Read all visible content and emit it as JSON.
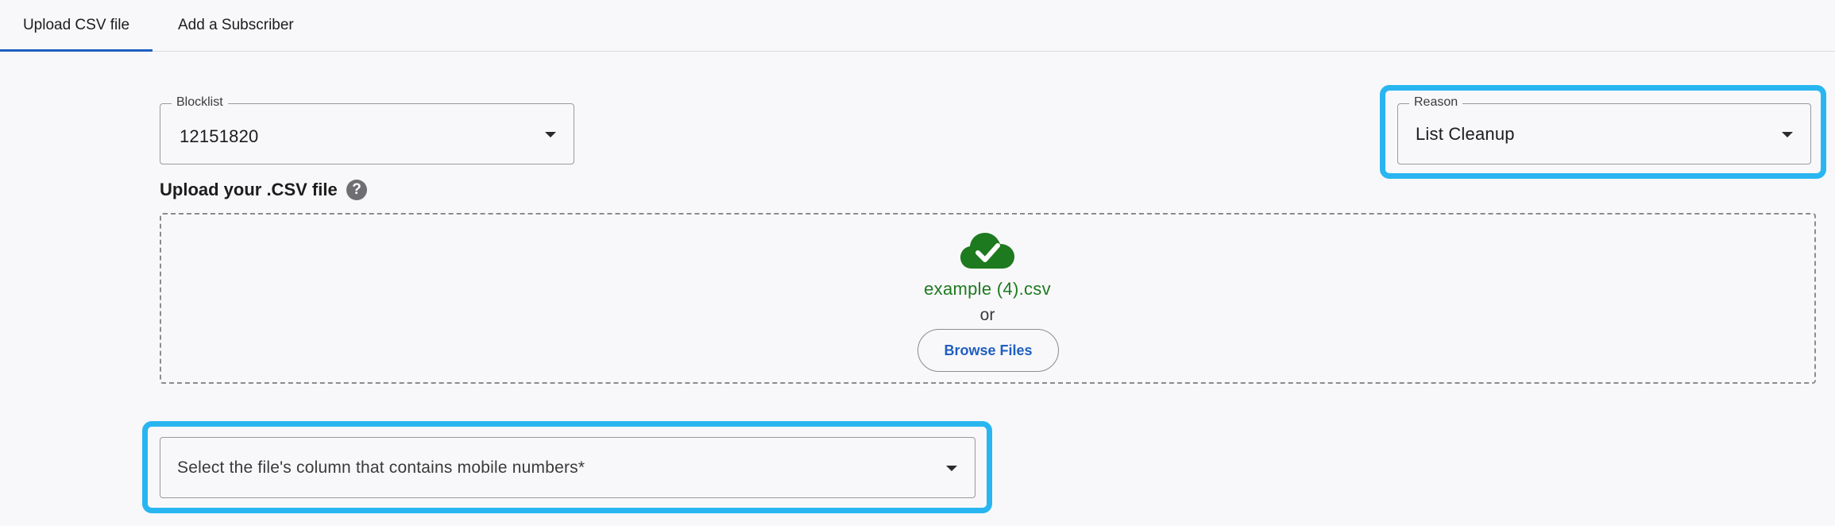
{
  "tabs": [
    {
      "label": "Upload CSV file",
      "active": true
    },
    {
      "label": "Add a Subscriber",
      "active": false
    }
  ],
  "blocklist": {
    "label": "Blocklist",
    "value": "12151820"
  },
  "reason": {
    "label": "Reason",
    "value": "List Cleanup"
  },
  "upload": {
    "label": "Upload your .CSV file",
    "help_icon": "question-circle-icon",
    "file_icon": "cloud-check-icon",
    "file_name": "example (4).csv",
    "or_text": "or",
    "browse_label": "Browse Files"
  },
  "column_select": {
    "placeholder": "Select the file's column that contains mobile numbers*"
  },
  "colors": {
    "accent": "#1f5fbf",
    "highlight": "#29b6f0",
    "success": "#1e7a1e",
    "background": "#f8f8fb"
  }
}
